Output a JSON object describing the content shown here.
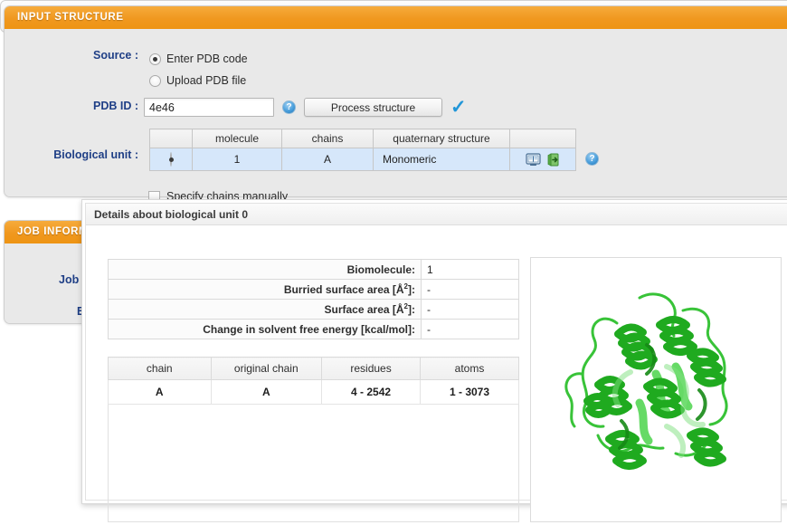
{
  "input_structure": {
    "header": "INPUT STRUCTURE",
    "source_label": "Source :",
    "source_options": [
      {
        "label": "Enter PDB code",
        "selected": true
      },
      {
        "label": "Upload PDB file",
        "selected": false
      }
    ],
    "pdb_id_label": "PDB ID :",
    "pdb_id_value": "4e46",
    "pdb_id_placeholder": "",
    "help_icon": "?",
    "process_button": "Process structure",
    "status_check": "✓",
    "biological_unit_label": "Biological unit :",
    "bio_table": {
      "headers": [
        "",
        "molecule",
        "chains",
        "quaternary structure",
        ""
      ],
      "rows": [
        {
          "selected": true,
          "molecule": "1",
          "chains": "A",
          "quaternary": "Monomeric"
        }
      ]
    },
    "specify_chains_label": "Specify chains manually",
    "specify_chains_checked": false
  },
  "job_information": {
    "header": "JOB INFORMATION",
    "label_job": "Job",
    "label_email": "E"
  },
  "details_dialog": {
    "title": "Details about biological unit 0",
    "details": [
      {
        "key": "Biomolecule:",
        "value": "1"
      },
      {
        "key": "Burried surface area [Å2]:",
        "value": "-"
      },
      {
        "key": "Surface area [Å2]:",
        "value": "-"
      },
      {
        "key": "Change in solvent free energy [kcal/mol]:",
        "value": "-"
      }
    ],
    "chain_table": {
      "headers": [
        "chain",
        "original chain",
        "residues",
        "atoms"
      ],
      "rows": [
        {
          "chain": "A",
          "original_chain": "A",
          "residues": "4 - 2542",
          "atoms": "1 - 3073"
        }
      ]
    },
    "viewer": {
      "name": "protein-ribbon-viewer",
      "structure_color": "#22bb22"
    }
  },
  "colors": {
    "header_orange": "#ee9414",
    "label_blue": "#1f3f86",
    "row_highlight": "#d6e7fa",
    "accent_blue": "#2196d8",
    "protein_green": "#22bb22"
  }
}
